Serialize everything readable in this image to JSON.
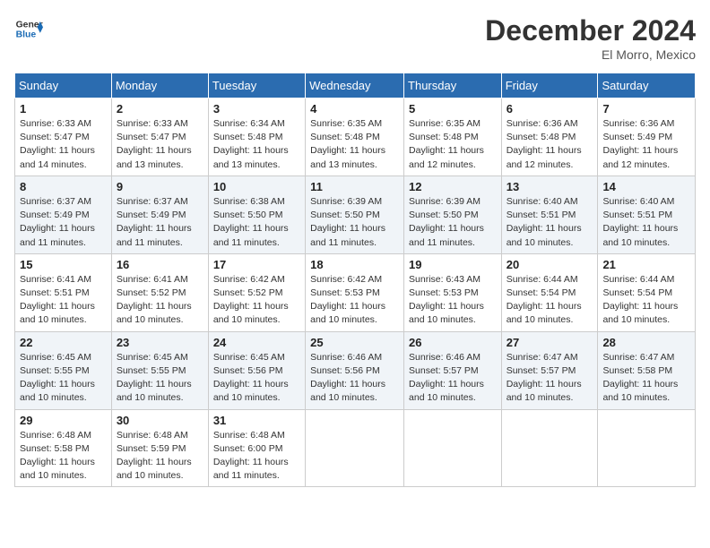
{
  "header": {
    "logo_line1": "General",
    "logo_line2": "Blue",
    "month_title": "December 2024",
    "location": "El Morro, Mexico"
  },
  "weekdays": [
    "Sunday",
    "Monday",
    "Tuesday",
    "Wednesday",
    "Thursday",
    "Friday",
    "Saturday"
  ],
  "weeks": [
    [
      {
        "day": "1",
        "sunrise": "6:33 AM",
        "sunset": "5:47 PM",
        "daylight": "11 hours and 14 minutes."
      },
      {
        "day": "2",
        "sunrise": "6:33 AM",
        "sunset": "5:47 PM",
        "daylight": "11 hours and 13 minutes."
      },
      {
        "day": "3",
        "sunrise": "6:34 AM",
        "sunset": "5:48 PM",
        "daylight": "11 hours and 13 minutes."
      },
      {
        "day": "4",
        "sunrise": "6:35 AM",
        "sunset": "5:48 PM",
        "daylight": "11 hours and 13 minutes."
      },
      {
        "day": "5",
        "sunrise": "6:35 AM",
        "sunset": "5:48 PM",
        "daylight": "11 hours and 12 minutes."
      },
      {
        "day": "6",
        "sunrise": "6:36 AM",
        "sunset": "5:48 PM",
        "daylight": "11 hours and 12 minutes."
      },
      {
        "day": "7",
        "sunrise": "6:36 AM",
        "sunset": "5:49 PM",
        "daylight": "11 hours and 12 minutes."
      }
    ],
    [
      {
        "day": "8",
        "sunrise": "6:37 AM",
        "sunset": "5:49 PM",
        "daylight": "11 hours and 11 minutes."
      },
      {
        "day": "9",
        "sunrise": "6:37 AM",
        "sunset": "5:49 PM",
        "daylight": "11 hours and 11 minutes."
      },
      {
        "day": "10",
        "sunrise": "6:38 AM",
        "sunset": "5:50 PM",
        "daylight": "11 hours and 11 minutes."
      },
      {
        "day": "11",
        "sunrise": "6:39 AM",
        "sunset": "5:50 PM",
        "daylight": "11 hours and 11 minutes."
      },
      {
        "day": "12",
        "sunrise": "6:39 AM",
        "sunset": "5:50 PM",
        "daylight": "11 hours and 11 minutes."
      },
      {
        "day": "13",
        "sunrise": "6:40 AM",
        "sunset": "5:51 PM",
        "daylight": "11 hours and 10 minutes."
      },
      {
        "day": "14",
        "sunrise": "6:40 AM",
        "sunset": "5:51 PM",
        "daylight": "11 hours and 10 minutes."
      }
    ],
    [
      {
        "day": "15",
        "sunrise": "6:41 AM",
        "sunset": "5:51 PM",
        "daylight": "11 hours and 10 minutes."
      },
      {
        "day": "16",
        "sunrise": "6:41 AM",
        "sunset": "5:52 PM",
        "daylight": "11 hours and 10 minutes."
      },
      {
        "day": "17",
        "sunrise": "6:42 AM",
        "sunset": "5:52 PM",
        "daylight": "11 hours and 10 minutes."
      },
      {
        "day": "18",
        "sunrise": "6:42 AM",
        "sunset": "5:53 PM",
        "daylight": "11 hours and 10 minutes."
      },
      {
        "day": "19",
        "sunrise": "6:43 AM",
        "sunset": "5:53 PM",
        "daylight": "11 hours and 10 minutes."
      },
      {
        "day": "20",
        "sunrise": "6:44 AM",
        "sunset": "5:54 PM",
        "daylight": "11 hours and 10 minutes."
      },
      {
        "day": "21",
        "sunrise": "6:44 AM",
        "sunset": "5:54 PM",
        "daylight": "11 hours and 10 minutes."
      }
    ],
    [
      {
        "day": "22",
        "sunrise": "6:45 AM",
        "sunset": "5:55 PM",
        "daylight": "11 hours and 10 minutes."
      },
      {
        "day": "23",
        "sunrise": "6:45 AM",
        "sunset": "5:55 PM",
        "daylight": "11 hours and 10 minutes."
      },
      {
        "day": "24",
        "sunrise": "6:45 AM",
        "sunset": "5:56 PM",
        "daylight": "11 hours and 10 minutes."
      },
      {
        "day": "25",
        "sunrise": "6:46 AM",
        "sunset": "5:56 PM",
        "daylight": "11 hours and 10 minutes."
      },
      {
        "day": "26",
        "sunrise": "6:46 AM",
        "sunset": "5:57 PM",
        "daylight": "11 hours and 10 minutes."
      },
      {
        "day": "27",
        "sunrise": "6:47 AM",
        "sunset": "5:57 PM",
        "daylight": "11 hours and 10 minutes."
      },
      {
        "day": "28",
        "sunrise": "6:47 AM",
        "sunset": "5:58 PM",
        "daylight": "11 hours and 10 minutes."
      }
    ],
    [
      {
        "day": "29",
        "sunrise": "6:48 AM",
        "sunset": "5:58 PM",
        "daylight": "11 hours and 10 minutes."
      },
      {
        "day": "30",
        "sunrise": "6:48 AM",
        "sunset": "5:59 PM",
        "daylight": "11 hours and 10 minutes."
      },
      {
        "day": "31",
        "sunrise": "6:48 AM",
        "sunset": "6:00 PM",
        "daylight": "11 hours and 11 minutes."
      },
      null,
      null,
      null,
      null
    ]
  ],
  "labels": {
    "sunrise": "Sunrise:",
    "sunset": "Sunset:",
    "daylight": "Daylight:"
  }
}
